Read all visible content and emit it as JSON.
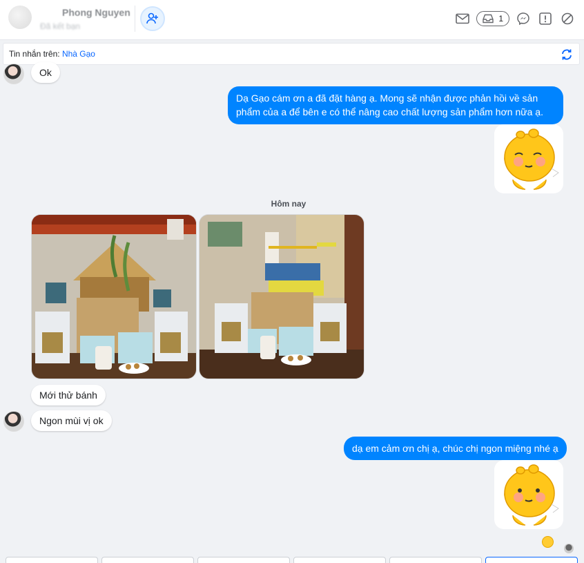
{
  "header": {
    "name": "Phong Nguyen",
    "subtitle": "Đã kết bạn",
    "inbox_count": "1"
  },
  "subbar": {
    "label": "Tin nhắn trên:",
    "page_name": "Nhà Gạo"
  },
  "messages": {
    "ok": "Ok",
    "out1": "Dạ Gạo cám ơn a đã đặt hàng ạ. Mong sẽ nhận được phản hồi về sản phẩm của a để bên e có thể nâng cao chất lượng sản phẩm hơn nữa ạ.",
    "date_separator": "Hôm nay",
    "in2": "Mới thử bánh",
    "in3": "Ngon mùi vị ok",
    "out2": "dạ em cảm ơn chị ạ, chúc chị ngon miệng nhé ạ"
  },
  "colors": {
    "accent": "#0866ff",
    "bubble_out": "#0084ff",
    "background": "#f0f2f5"
  },
  "icons": [
    "add-friend-icon",
    "mail-icon",
    "inbox-icon",
    "messenger-icon",
    "alert-icon",
    "block-icon",
    "sync-icon",
    "sticker-icon",
    "reaction-emoji-icon"
  ]
}
